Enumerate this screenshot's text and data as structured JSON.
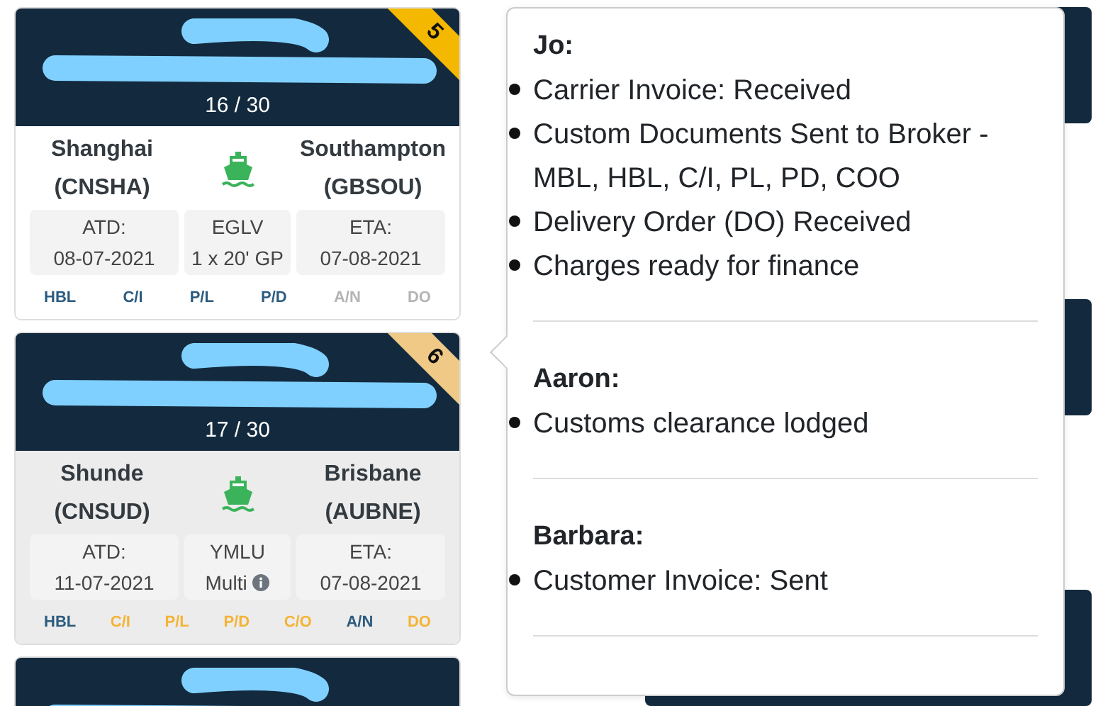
{
  "cards": [
    {
      "redacted": true,
      "ribbon": {
        "label": "5",
        "color": "#f5b800"
      },
      "progress": "16 / 30",
      "highlighted": false,
      "origin": {
        "city": "Shanghai",
        "code": "(CNSHA)"
      },
      "destination": {
        "city": "Southampton",
        "code": "(GBSOU)"
      },
      "departure": {
        "label": "ATD:",
        "date": "08-07-2021"
      },
      "carrier": {
        "code": "EGLV",
        "containers": "1 x 20' GP",
        "info": false
      },
      "arrival": {
        "label": "ETA:",
        "date": "07-08-2021"
      },
      "documents": [
        {
          "label": "HBL",
          "color": "#2c5b7f"
        },
        {
          "label": "C/I",
          "color": "#2c5b7f"
        },
        {
          "label": "P/L",
          "color": "#2c5b7f"
        },
        {
          "label": "P/D",
          "color": "#2c5b7f"
        },
        {
          "label": "A/N",
          "color": "#b4b4b4"
        },
        {
          "label": "DO",
          "color": "#b4b4b4"
        }
      ]
    },
    {
      "redacted": true,
      "ribbon": {
        "label": "6",
        "color": "#f0c987"
      },
      "progress": "17 / 30",
      "highlighted": true,
      "origin": {
        "city": "Shunde",
        "code": "(CNSUD)"
      },
      "destination": {
        "city": "Brisbane",
        "code": "(AUBNE)"
      },
      "departure": {
        "label": "ATD:",
        "date": "11-07-2021"
      },
      "carrier": {
        "code": "YMLU",
        "containers": "Multi",
        "info": true
      },
      "arrival": {
        "label": "ETA:",
        "date": "07-08-2021"
      },
      "documents": [
        {
          "label": "HBL",
          "color": "#2c5b7f"
        },
        {
          "label": "C/I",
          "color": "#f5b335"
        },
        {
          "label": "P/L",
          "color": "#f5b335"
        },
        {
          "label": "P/D",
          "color": "#f5b335"
        },
        {
          "label": "C/O",
          "color": "#f5b335"
        },
        {
          "label": "A/N",
          "color": "#2c5b7f"
        },
        {
          "label": "DO",
          "color": "#f5b335"
        }
      ]
    },
    {
      "redacted": true
    }
  ],
  "popover": {
    "sections": [
      {
        "name": "Jo:",
        "notes": [
          "Carrier Invoice: Received",
          "Custom Documents Sent to Broker - MBL, HBL, C/I, PL, PD, COO",
          "Delivery Order (DO) Received",
          "Charges ready for finance"
        ]
      },
      {
        "name": "Aaron:",
        "notes": [
          "Customs clearance lodged"
        ]
      },
      {
        "name": "Barbara:",
        "notes": [
          "Customer Invoice: Sent"
        ]
      }
    ]
  }
}
